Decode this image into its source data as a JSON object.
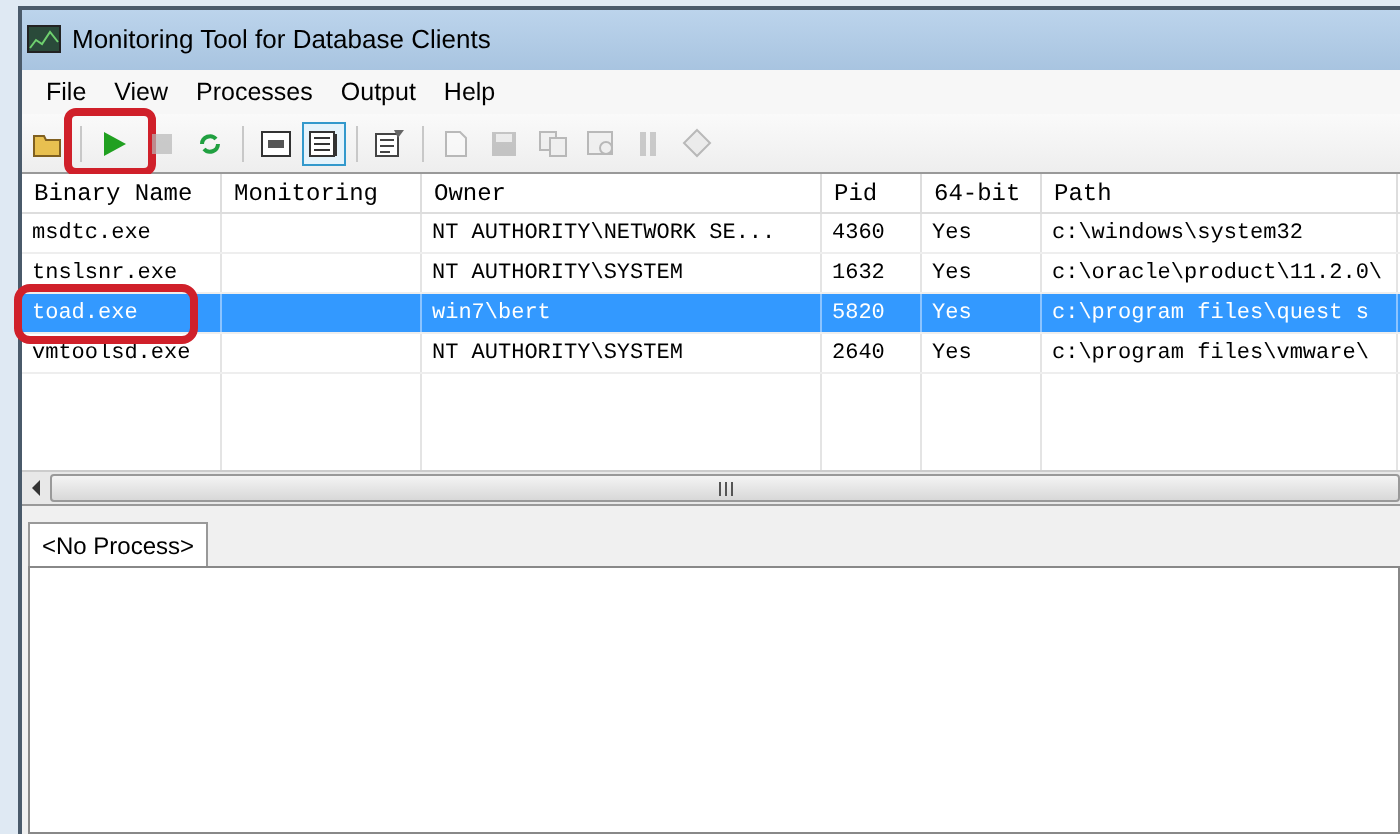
{
  "window": {
    "title": "Monitoring Tool for Database Clients"
  },
  "menu": [
    "File",
    "View",
    "Processes",
    "Output",
    "Help"
  ],
  "toolbar": [
    {
      "kind": "folder",
      "disabled": false,
      "highlighted": false
    },
    {
      "kind": "sep"
    },
    {
      "kind": "play",
      "disabled": false,
      "highlighted": true
    },
    {
      "kind": "stop",
      "disabled": true,
      "highlighted": false
    },
    {
      "kind": "refresh",
      "disabled": false,
      "highlighted": false
    },
    {
      "kind": "sep"
    },
    {
      "kind": "window",
      "disabled": false,
      "highlighted": false
    },
    {
      "kind": "list",
      "disabled": false,
      "selected": true,
      "highlighted": false
    },
    {
      "kind": "sep"
    },
    {
      "kind": "properties",
      "disabled": false,
      "highlighted": false
    },
    {
      "kind": "sep"
    },
    {
      "kind": "page",
      "disabled": true,
      "highlighted": false
    },
    {
      "kind": "save",
      "disabled": true,
      "highlighted": false
    },
    {
      "kind": "copy",
      "disabled": true,
      "highlighted": false
    },
    {
      "kind": "preview",
      "disabled": true,
      "highlighted": false
    },
    {
      "kind": "pause",
      "disabled": true,
      "highlighted": false
    },
    {
      "kind": "diamond",
      "disabled": true,
      "highlighted": false
    }
  ],
  "table": {
    "columns": [
      "Binary Name",
      "Monitoring",
      "Owner",
      "Pid",
      "64-bit",
      "Path"
    ],
    "rows": [
      {
        "cells": [
          "msdtc.exe",
          "",
          "NT AUTHORITY\\NETWORK SE...",
          "4360",
          "Yes",
          "c:\\windows\\system32"
        ],
        "selected": false,
        "highlighted": false
      },
      {
        "cells": [
          "tnslsnr.exe",
          "",
          "NT AUTHORITY\\SYSTEM",
          "1632",
          "Yes",
          "c:\\oracle\\product\\11.2.0\\"
        ],
        "selected": false,
        "highlighted": false
      },
      {
        "cells": [
          "toad.exe",
          "",
          "win7\\bert",
          "5820",
          "Yes",
          "c:\\program files\\quest s"
        ],
        "selected": true,
        "highlighted": true
      },
      {
        "cells": [
          "vmtoolsd.exe",
          "",
          "NT AUTHORITY\\SYSTEM",
          "2640",
          "Yes",
          "c:\\program files\\vmware\\"
        ],
        "selected": false,
        "highlighted": false
      }
    ]
  },
  "output_tabs": [
    {
      "label": "<No Process>",
      "selected": true
    }
  ]
}
